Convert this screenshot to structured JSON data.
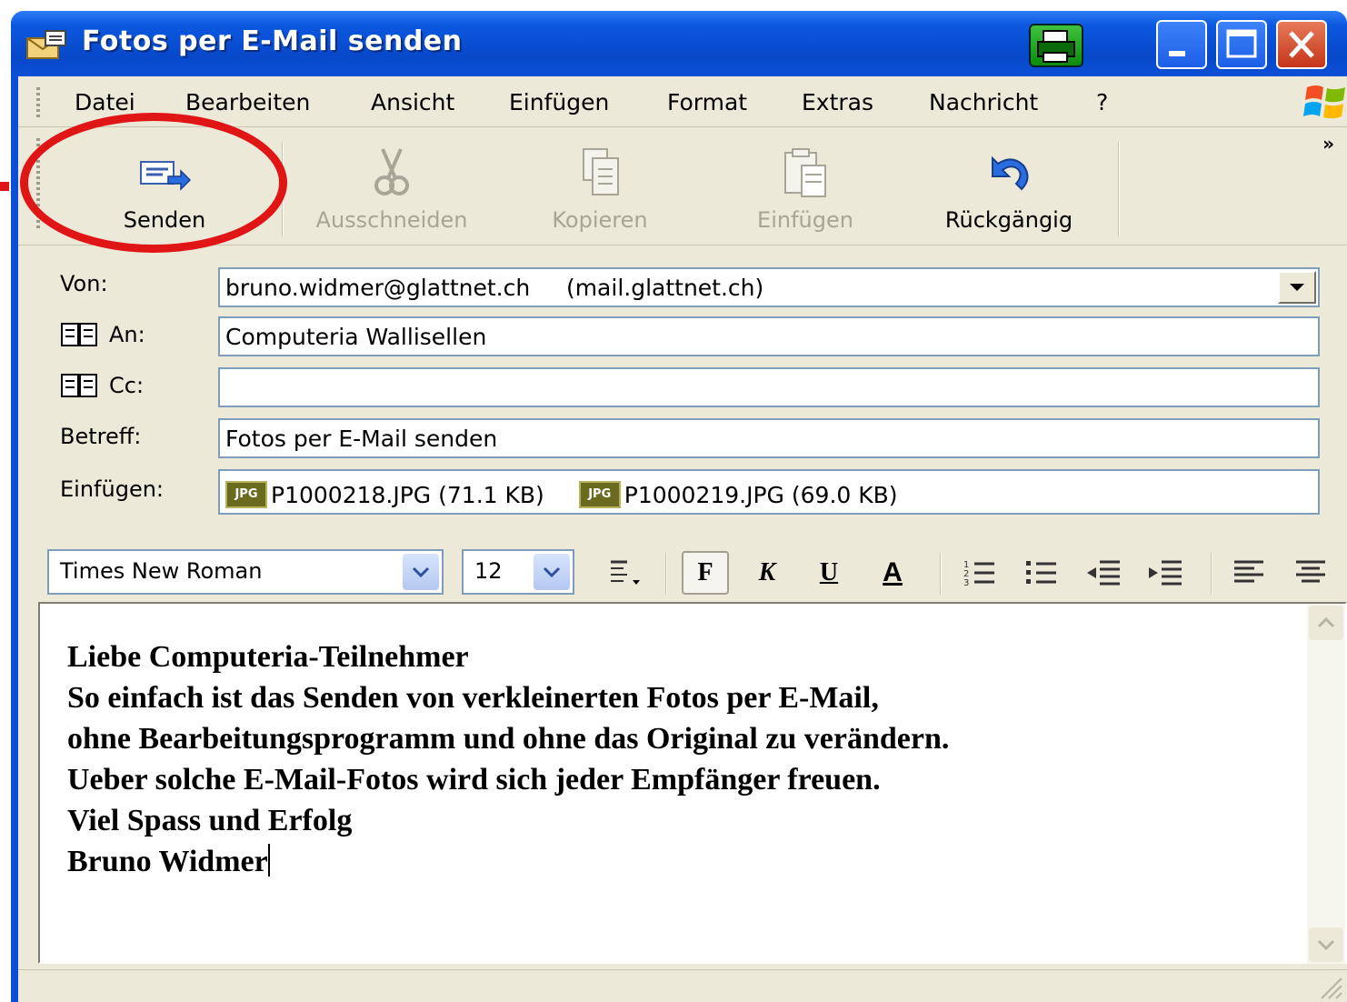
{
  "window": {
    "title": "Fotos per E-Mail senden",
    "controls": [
      "print-icon",
      "minimize-icon",
      "maximize-icon",
      "close-icon"
    ]
  },
  "menu": {
    "items": [
      "Datei",
      "Bearbeiten",
      "Ansicht",
      "Einfügen",
      "Format",
      "Extras",
      "Nachricht",
      "?"
    ]
  },
  "toolbar": {
    "send": "Senden",
    "cut": "Ausschneiden",
    "copy": "Kopieren",
    "paste": "Einfügen",
    "undo": "Rückgängig",
    "more": "»"
  },
  "header": {
    "from_label": "Von:",
    "from_value": "bruno.widmer@glattnet.ch     (mail.glattnet.ch)",
    "to_label": "An:",
    "to_value": "Computeria Wallisellen",
    "cc_label": "Cc:",
    "cc_value": "",
    "subject_label": "Betreff:",
    "subject_value": "Fotos per E-Mail senden",
    "attach_label": "Einfügen:",
    "attachments": [
      {
        "name": "P1000218.JPG (71.1 KB)",
        "type": "JPG"
      },
      {
        "name": "P1000219.JPG (69.0 KB)",
        "type": "JPG"
      }
    ]
  },
  "format": {
    "font": "Times New Roman",
    "size": "12",
    "bold": "F",
    "italic": "K",
    "underline": "U",
    "color": "A"
  },
  "body": {
    "lines": [
      "Liebe Computeria-Teilnehmer",
      "So einfach ist das Senden von verkleinerten Fotos per E-Mail,",
      "ohne Bearbeitungsprogramm und ohne das Original zu verändern.",
      "Ueber solche E-Mail-Fotos wird sich jeder Empfänger freuen.",
      "Viel Spass und Erfolg",
      "Bruno Widmer"
    ]
  },
  "colors": {
    "titlebar": "#0a4fd6",
    "chrome": "#ece9d8",
    "highlight": "#e01515"
  }
}
